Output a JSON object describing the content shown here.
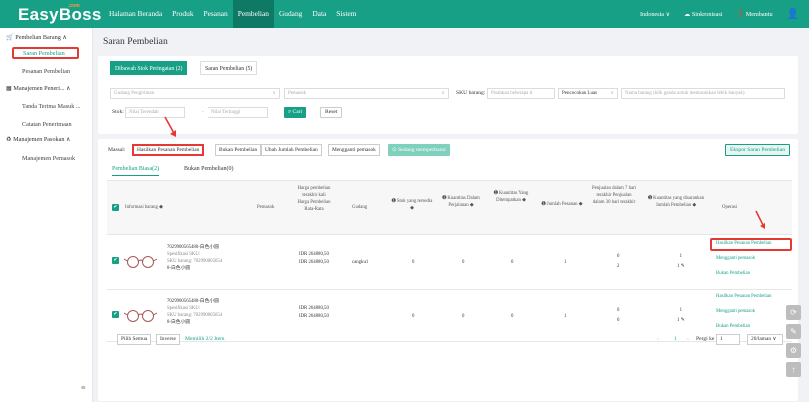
{
  "app": {
    "logo": "EasyBoss",
    "logo_sup": ".com"
  },
  "nav": {
    "items": [
      "Halaman Beranda",
      "Produk",
      "Pesanan",
      "Pembelian",
      "Gudang",
      "Data",
      "Sistem"
    ],
    "active_index": 3
  },
  "topright": {
    "region": "Indonesia",
    "sync": "Sinkronisasi",
    "help": "Membantu"
  },
  "sidebar": {
    "group1": "Pembelian Barang",
    "item1a": "Saran Pembelian",
    "item1b": "Pesanan Pembelian",
    "group2": "Manajemen Peneri...",
    "item2a": "Tanda Terima Masuk ...",
    "item2b": "Catatan Penerimaan",
    "group3": "Manajemen Pasokan",
    "item3a": "Manajemen Pemasok"
  },
  "page": {
    "title": "Saran Pembelian"
  },
  "filter": {
    "tab_active": "Dibawah Stok Peringatan (2)",
    "tab_other": "Saran Pembelian (5)",
    "warehouse_ph": "Gudang Pengiriman",
    "supplier_ph": "Pemasok",
    "sku_label": "SKU barang:",
    "sku_ph": "Pisahkan beberapa it",
    "match": "Pencocokan Luas",
    "name_ph": "Nama barang (klik ganda untuk memasukkan lebih banyak)",
    "stock_label": "Stok:",
    "min_ph": "Nilai Terendah",
    "sep": "-",
    "max_ph": "Nilai Tertinggi",
    "search_btn": "Cari",
    "reset_btn": "Reset"
  },
  "bulk": {
    "label": "Massal:",
    "b1": "Hasilkan Pesanan Pembelian",
    "b2": "Bukan Pembelian",
    "b3": "Ubah Jumlah Pembelian",
    "b4": "Mengganti pemasok",
    "syncing": "Sedang memperbarui",
    "export": "Ekspor Saran Pembelian"
  },
  "subtabs": {
    "active": "Pembelian Biasa(2)",
    "other": "Bukan Pembelian(0)"
  },
  "table": {
    "headers": {
      "info": "Informasi barang",
      "supplier": "Pemasok",
      "price": "Harga pembelian terakhir kali Harga Pembelian Rata-Rata",
      "warehouse": "Gudang",
      "stock": "Stok yang tersedia",
      "quantity": "Kuantitas Dalam Perjalanan",
      "quantity2": "Kuantitas Yang Ditempatkan",
      "qty_label": "Kuantitas Yang Ditempatkan",
      "pending": "Jumlah Pesanan",
      "sales": "Penjualan dalam 7 hari terakhir Penjualan dalam 30 hari terakhir",
      "suggest": "Kuantitas yang disarankan Jumlah Pembelian",
      "op": "Operasi"
    },
    "rows": [
      {
        "name": "7029900565480-白色小圆",
        "spec": "Spesifikasi SKU:",
        "sku": "SKU barang: 702990005654",
        "sku2": "8-白色小圆",
        "price1": "IDR 264880,50",
        "price2": "IDR 264880,50",
        "warehouse": "cangku1",
        "stock": "0",
        "transit": "0",
        "placed": "0",
        "pending": "1",
        "s7": "0",
        "s30": "2",
        "suggest": "1",
        "qty": "1"
      },
      {
        "name": "7029900565480-白色小圆",
        "spec": "Spesifikasi SKU:",
        "sku": "SKU barang: 702990005654",
        "sku2": "8-白色小圆",
        "price1": "IDR 264880,50",
        "price2": "IDR 264880,50",
        "warehouse": "",
        "stock": "0",
        "transit": "0",
        "placed": "0",
        "pending": "1",
        "s7": "0",
        "s30": "0",
        "suggest": "1",
        "qty": "1"
      }
    ],
    "ops": [
      "Hasilkan Pesanan Pembelian",
      "Mengganti pemasok",
      "Bukan Pembelian"
    ]
  },
  "footer": {
    "select_all": "Pilih Semua",
    "invert": "Inverse",
    "selected": "Memilih 2/2 Item",
    "page": "1",
    "goto": "Pergi ke",
    "goto_val": "1",
    "per_page": "20/laman"
  }
}
